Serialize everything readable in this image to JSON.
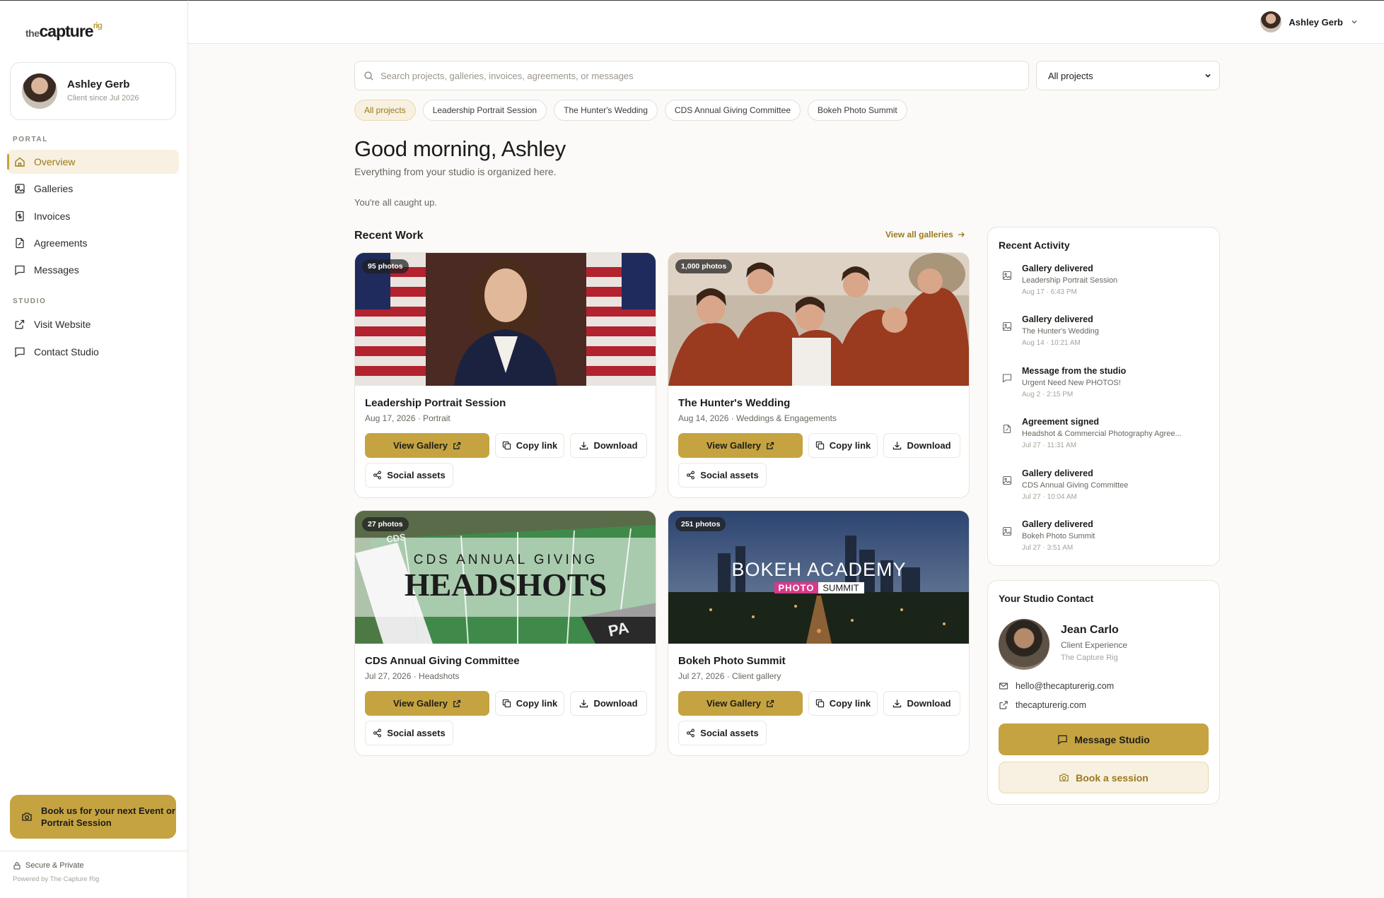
{
  "brand": {
    "logo_the": "the",
    "logo_capture": "capture",
    "logo_rig": "rig",
    "accent": "#c5a340"
  },
  "profile": {
    "name": "Ashley Gerb",
    "since": "Client since Jul 2026"
  },
  "sidebar": {
    "portal_label": "PORTAL",
    "portal_items": [
      {
        "label": "Overview",
        "icon": "home-icon"
      },
      {
        "label": "Galleries",
        "icon": "image-icon"
      },
      {
        "label": "Invoices",
        "icon": "invoice-icon"
      },
      {
        "label": "Agreements",
        "icon": "document-icon"
      },
      {
        "label": "Messages",
        "icon": "chat-icon"
      }
    ],
    "studio_label": "STUDIO",
    "studio_items": [
      {
        "label": "Visit Website",
        "icon": "external-link-icon"
      },
      {
        "label": "Contact Studio",
        "icon": "chat-icon"
      }
    ],
    "book_cta": "Book us for your next Event or Portrait Session",
    "secure": "Secure & Private",
    "powered": "Powered by The Capture Rig"
  },
  "topbar": {
    "user_name": "Ashley Gerb"
  },
  "search": {
    "placeholder": "Search projects, galleries, invoices, agreements, or messages",
    "filter_value": "All projects"
  },
  "chips": [
    "All projects",
    "Leadership Portrait Session",
    "The Hunter's Wedding",
    "CDS Annual Giving Committee",
    "Bokeh Photo Summit"
  ],
  "greeting": {
    "title": "Good morning, Ashley",
    "subtitle": "Everything from your studio is organized here.",
    "status": "You're all caught up."
  },
  "recent": {
    "title": "Recent Work",
    "view_all": "View all galleries",
    "buttons": {
      "view": "View Gallery",
      "copy": "Copy link",
      "download": "Download",
      "social": "Social assets"
    },
    "galleries": [
      {
        "badge": "95 photos",
        "title": "Leadership Portrait Session",
        "meta": "Aug 17, 2026 · Portrait"
      },
      {
        "badge": "1,000 photos",
        "title": "The Hunter's Wedding",
        "meta": "Aug 14, 2026 · Weddings & Engagements"
      },
      {
        "badge": "27 photos",
        "title": "CDS Annual Giving Committee",
        "meta": "Jul 27, 2026 · Headshots",
        "cover_line1": "CDS ANNUAL GIVING",
        "cover_line2": "HEADSHOTS",
        "cover_field_text": "CDS",
        "cover_endzone": "PA"
      },
      {
        "badge": "251 photos",
        "title": "Bokeh Photo Summit",
        "meta": "Jul 27, 2026 · Client gallery",
        "cover_line1": "BOKEH ACADEMY",
        "cover_photo": "PHOTO",
        "cover_summit": "SUMMIT"
      }
    ]
  },
  "activity": {
    "title": "Recent Activity",
    "items": [
      {
        "title": "Gallery delivered",
        "sub": "Leadership Portrait Session",
        "time": "Aug 17 · 6:43 PM",
        "icon": "image-icon"
      },
      {
        "title": "Gallery delivered",
        "sub": "The Hunter's Wedding",
        "time": "Aug 14 · 10:21 AM",
        "icon": "image-icon"
      },
      {
        "title": "Message from the studio",
        "sub": "Urgent Need New PHOTOS!",
        "time": "Aug 2 · 2:15 PM",
        "icon": "chat-icon"
      },
      {
        "title": "Agreement signed",
        "sub": "Headshot & Commercial Photography Agree...",
        "time": "Jul 27 · 11:31 AM",
        "icon": "document-icon"
      },
      {
        "title": "Gallery delivered",
        "sub": "CDS Annual Giving Committee",
        "time": "Jul 27 · 10:04 AM",
        "icon": "image-icon"
      },
      {
        "title": "Gallery delivered",
        "sub": "Bokeh Photo Summit",
        "time": "Jul 27 · 3:51 AM",
        "icon": "image-icon"
      }
    ]
  },
  "contact": {
    "title": "Your Studio Contact",
    "name": "Jean Carlo",
    "role": "Client Experience",
    "org": "The Capture Rig",
    "email": "hello@thecapturerig.com",
    "website": "thecapturerig.com",
    "message_btn": "Message Studio",
    "book_btn": "Book a session"
  }
}
